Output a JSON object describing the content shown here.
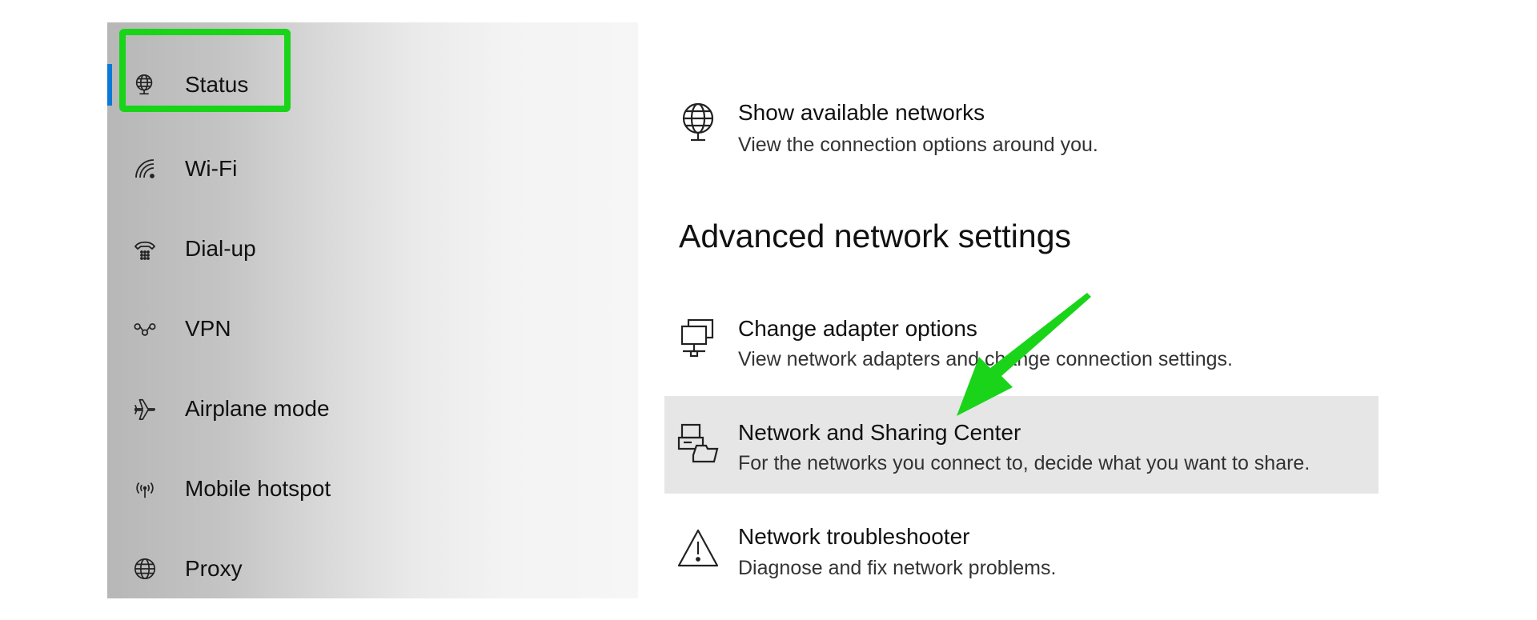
{
  "sidebar": {
    "items": [
      {
        "label": "Status",
        "icon": "globe-monitor-icon",
        "selected": true
      },
      {
        "label": "Wi-Fi",
        "icon": "wifi-icon"
      },
      {
        "label": "Dial-up",
        "icon": "dialup-phone-icon"
      },
      {
        "label": "VPN",
        "icon": "vpn-icon"
      },
      {
        "label": "Airplane mode",
        "icon": "airplane-icon"
      },
      {
        "label": "Mobile hotspot",
        "icon": "hotspot-icon"
      },
      {
        "label": "Proxy",
        "icon": "globe-icon"
      }
    ]
  },
  "main": {
    "show_networks": {
      "title": "Show available networks",
      "subtitle": "View the connection options around you.",
      "icon": "globe-monitor-icon"
    },
    "section_title": "Advanced network settings",
    "options": [
      {
        "title": "Change adapter options",
        "subtitle": "View network adapters and change connection settings.",
        "icon": "network-adapter-icon"
      },
      {
        "title": "Network and Sharing Center",
        "subtitle": "For the networks you connect to, decide what you want to share.",
        "icon": "sharing-center-icon"
      },
      {
        "title": "Network troubleshooter",
        "subtitle": "Diagnose and fix network problems.",
        "icon": "warning-icon"
      }
    ]
  },
  "colors": {
    "accent": "#0a78d7",
    "annotation_green": "#19d419",
    "hover_background": "#e6e6e6"
  }
}
